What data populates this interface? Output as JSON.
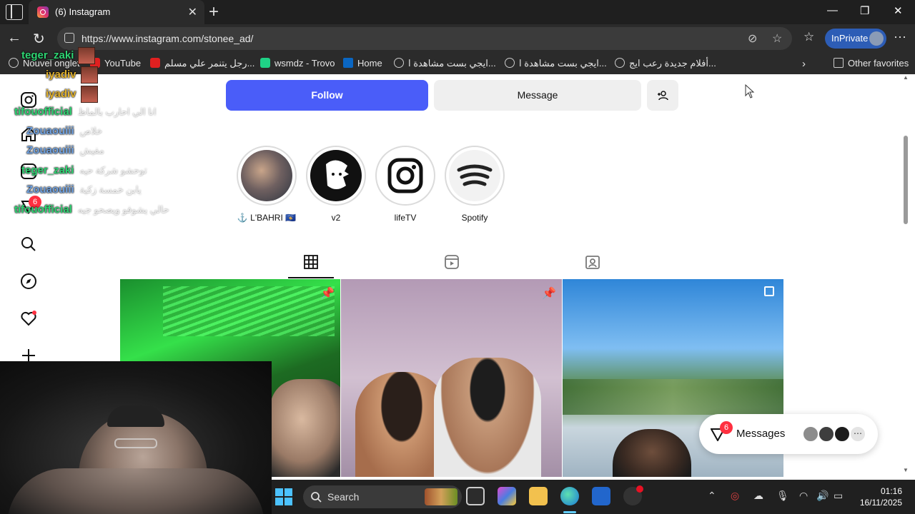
{
  "browser": {
    "tab_title": "(6) Instagram",
    "url": "https://www.instagram.com/stonee_ad/",
    "profile_label": "InPrivate"
  },
  "favorites": [
    {
      "label": "Nouvel onglet",
      "icon": "globe-icon"
    },
    {
      "label": "YouTube",
      "icon": "youtube-icon"
    },
    {
      "label": "رجل يتنمر علي مسلم...",
      "icon": "youtube-icon"
    },
    {
      "label": "wsmdz - Trovo",
      "icon": "trovo-icon"
    },
    {
      "label": "Home",
      "icon": "linkedin-icon"
    },
    {
      "label": "ايجي بست مشاهدة ا...",
      "icon": "globe-icon"
    },
    {
      "label": "ايجي بست مشاهدة ا...",
      "icon": "globe-icon"
    },
    {
      "label": "أفلام جديدة رعب ايج...",
      "icon": "globe-icon"
    }
  ],
  "other_favorites": "Other favorites",
  "profile": {
    "follow_label": "Follow",
    "message_label": "Message",
    "highlights": [
      {
        "label": "⚓ L'BAHRI 🇽🇰"
      },
      {
        "label": "v2"
      },
      {
        "label": "lifeTV"
      },
      {
        "label": "Spotify"
      }
    ]
  },
  "sidebar": {
    "notification_badge": "6"
  },
  "messages": {
    "label": "Messages",
    "badge": "6"
  },
  "chat": [
    {
      "name": "teger_zaki",
      "color": "#2ed573",
      "msg": ""
    },
    {
      "name": "iyadiv",
      "color": "#e1b12c",
      "msg": ""
    },
    {
      "name": "iyadiv",
      "color": "#e1b12c",
      "msg": ""
    },
    {
      "name": "tifouofficial",
      "color": "#2ed573",
      "msg": "انا الي احارب بالماظ"
    },
    {
      "name": "Zouaouiii",
      "color": "#6fa1e0",
      "msg": "خلاص"
    },
    {
      "name": "Zouaouiii",
      "color": "#6fa1e0",
      "msg": "مفيش"
    },
    {
      "name": "teger_zaki",
      "color": "#2ed573",
      "msg": "توحشو شركة حيه"
    },
    {
      "name": "Zouaouiii",
      "color": "#6fa1e0",
      "msg": "يابن خمسة زكية"
    },
    {
      "name": "tifouofficial",
      "color": "#2ed573",
      "msg": "حالي يشوفو ويصحو جيه"
    }
  ],
  "taskbar": {
    "search_label": "Search",
    "time": "01:16",
    "date": "16/11/2025"
  },
  "colors": {
    "follow_blue": "#4a5df9",
    "badge_red": "#ff3040",
    "chrome_dark": "#2b2b2b"
  }
}
